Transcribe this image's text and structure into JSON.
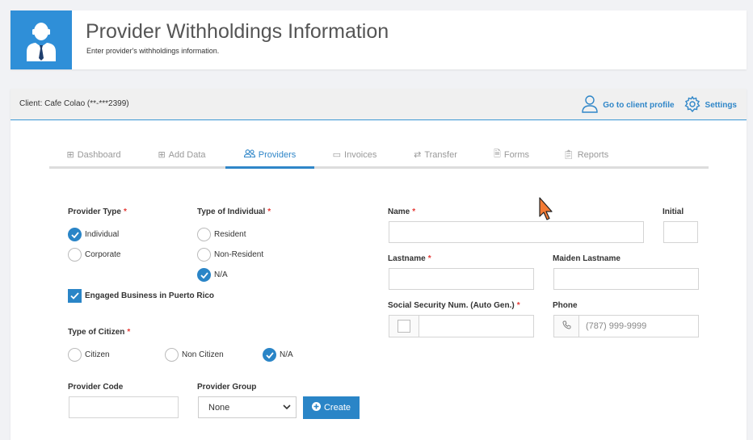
{
  "header": {
    "title": "Provider Withholdings Information",
    "subtitle": "Enter provider's withholdings information."
  },
  "client_bar": {
    "client_label": "Client: Cafe Colao (**-***2399)",
    "go_to_client_profile": "Go to client profile",
    "settings": "Settings"
  },
  "tabs": [
    {
      "label": "Dashboard",
      "icon": "dashboard-icon"
    },
    {
      "label": "Add Data",
      "icon": "plus-square-icon"
    },
    {
      "label": "Providers",
      "icon": "users-icon",
      "active": true
    },
    {
      "label": "Invoices",
      "icon": "invoice-icon"
    },
    {
      "label": "Transfer",
      "icon": "exchange-icon"
    },
    {
      "label": "Forms",
      "icon": "file-icon"
    },
    {
      "label": "Reports",
      "icon": "clipboard-icon"
    }
  ],
  "form": {
    "provider_type": {
      "label": "Provider Type",
      "options": [
        "Individual",
        "Corporate"
      ],
      "selected": "Individual"
    },
    "type_of_individual": {
      "label": "Type of Individual",
      "options": [
        "Resident",
        "Non-Resident",
        "N/A"
      ],
      "selected": "N/A"
    },
    "engaged_business": {
      "label": "Engaged Business in Puerto Rico",
      "checked": true
    },
    "type_of_citizen": {
      "label": "Type of Citizen",
      "options": [
        "Citizen",
        "Non Citizen",
        "N/A"
      ],
      "selected": "N/A"
    },
    "provider_code": {
      "label": "Provider Code",
      "value": ""
    },
    "provider_group": {
      "label": "Provider Group",
      "selected": "None",
      "create_label": "Create"
    },
    "name": {
      "label": "Name",
      "value": ""
    },
    "initial": {
      "label": "Initial",
      "value": ""
    },
    "lastname": {
      "label": "Lastname",
      "value": ""
    },
    "maiden_lastname": {
      "label": "Maiden Lastname",
      "value": ""
    },
    "ssn": {
      "label": "Social Security Num. (Auto Gen.)",
      "value": ""
    },
    "phone": {
      "label": "Phone",
      "placeholder": "(787) 999-9999"
    }
  },
  "colors": {
    "accent": "#2a85c7",
    "required": "#e53935",
    "header_icon_bg": "#2f8fd8"
  }
}
